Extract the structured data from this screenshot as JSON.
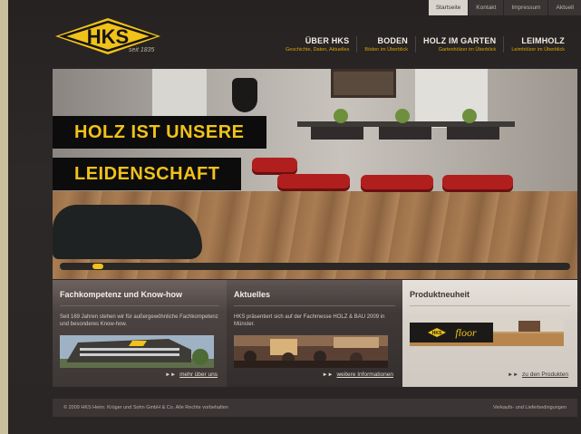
{
  "toplinks": [
    "Startseite",
    "Kontakt",
    "Impressum",
    "Aktuell"
  ],
  "logo": {
    "text": "HKS",
    "tagline": "seit 1835",
    "color_yellow": "#f0c21a",
    "color_dark": "#161414"
  },
  "mainnav": [
    {
      "title": "ÜBER HKS",
      "sub": "Geschichte, Daten, Aktuelles"
    },
    {
      "title": "BODEN",
      "sub": "Böden im Überblick"
    },
    {
      "title": "HOLZ IM GARTEN",
      "sub": "Gartenhölzer im Überblick"
    },
    {
      "title": "LEIMHOLZ",
      "sub": "Leimhölzer im Überblick"
    }
  ],
  "hero": {
    "line1": "HOLZ IST UNSERE",
    "line2": "LEIDENSCHAFT"
  },
  "boxes": [
    {
      "title": "Fachkompetenz und Know-how",
      "text": "Seit 169 Jahren stehen wir für außergewöhnliche Fachkompetenz und besonderes Know-how.",
      "link": "mehr über uns"
    },
    {
      "title": "Aktuelles",
      "text": "HKS präsentiert sich auf der Fachmesse HOLZ & BAU 2009 in Münster.",
      "link": "weitere Informationen"
    },
    {
      "title": "Produktneuheit",
      "text": "",
      "img_text_hks": "HKS",
      "img_text_floor": "floor",
      "link": "zu den Produkten"
    }
  ],
  "footer": {
    "copyright": "© 2009 HKS Heinr. Krüger und Sohn GmbH & Co. Alle Rechte vorbehalten",
    "terms": "Verkaufs- und Lieferbedingungen"
  }
}
